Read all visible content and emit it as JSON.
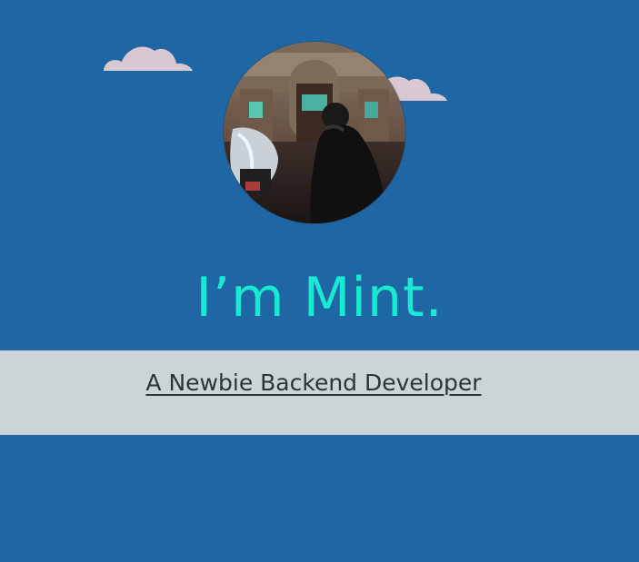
{
  "colors": {
    "background": "#1f67a4",
    "headline": "#18e9d2",
    "band": "#cbd5d5",
    "cloud": "#d8c8d2",
    "subtitle_text": "#2d3436"
  },
  "icons": {
    "cloud_left": "cloud-icon",
    "cloud_right": "cloud-icon"
  },
  "hero": {
    "headline": "I’m Mint.",
    "subtitle": "A Newbie Backend Developer"
  }
}
